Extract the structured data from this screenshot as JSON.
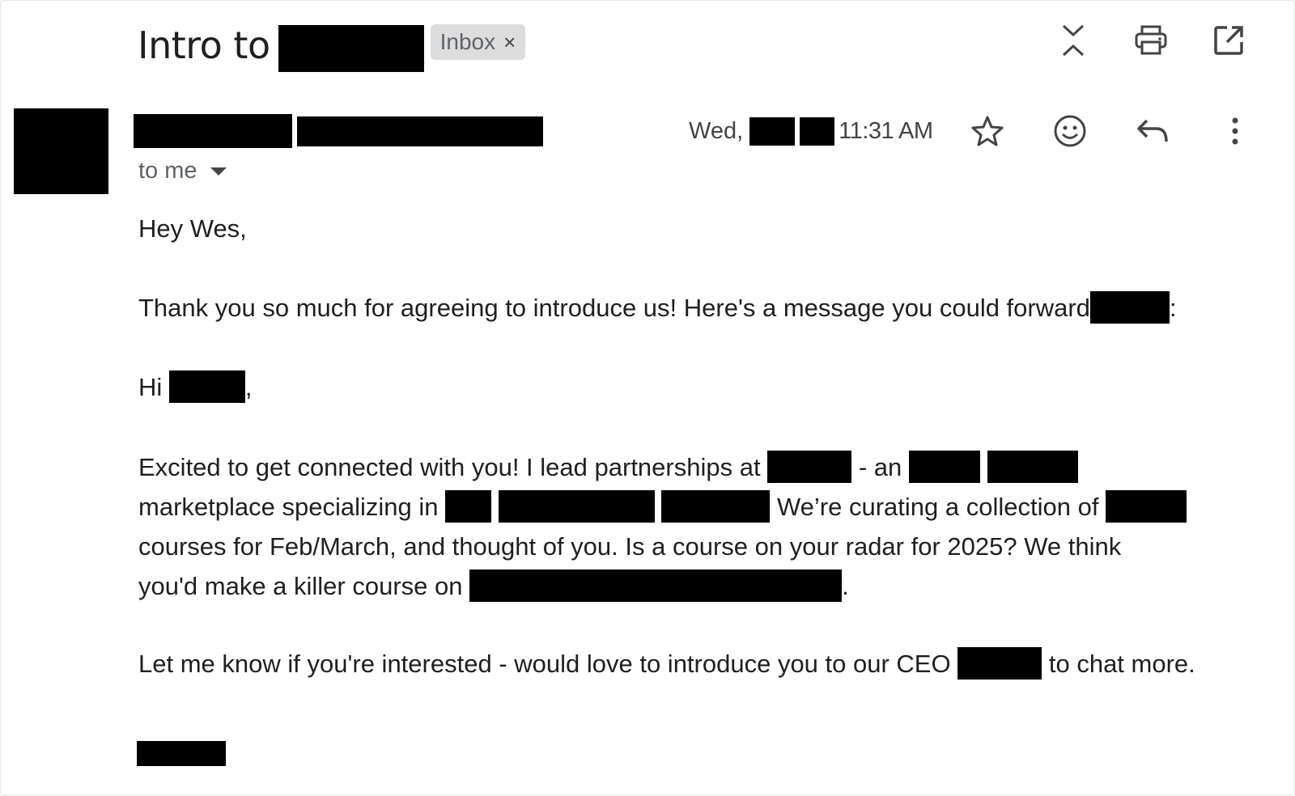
{
  "subject": {
    "title": "Intro to",
    "label_chip": "Inbox",
    "chip_close": "×"
  },
  "toolbar": {
    "icons": [
      "collapse-expand-icon",
      "print-icon",
      "open-in-new-window-icon"
    ]
  },
  "message": {
    "recipient_line": "to me",
    "date_prefix": "Wed,",
    "time": "11:31 AM",
    "actions": [
      "star-icon",
      "emoji-react-icon",
      "reply-icon",
      "more-options-icon"
    ]
  },
  "body": {
    "greeting": "Hey Wes,",
    "p1_text": "Thank you so much for agreeing to introduce us! Here's a message you could forward",
    "p1_end": ":",
    "hi_prefix": "Hi",
    "hi_end": ",",
    "p2_l1_a": "Excited to get connected with you! I lead partnerships at",
    "p2_l1_b": "- an",
    "p2_l2_a": "marketplace specializing in",
    "p2_l2_b": "We’re curating a collection of",
    "p2_l3": "courses for Feb/March, and thought of you. Is a course on your radar for 2025? We think",
    "p2_l4_a": "you'd make a killer course on",
    "p2_l4_end": ".",
    "p3_a": "Let me know if you're interested - would love to introduce you to our CEO",
    "p3_b": "to chat more."
  }
}
